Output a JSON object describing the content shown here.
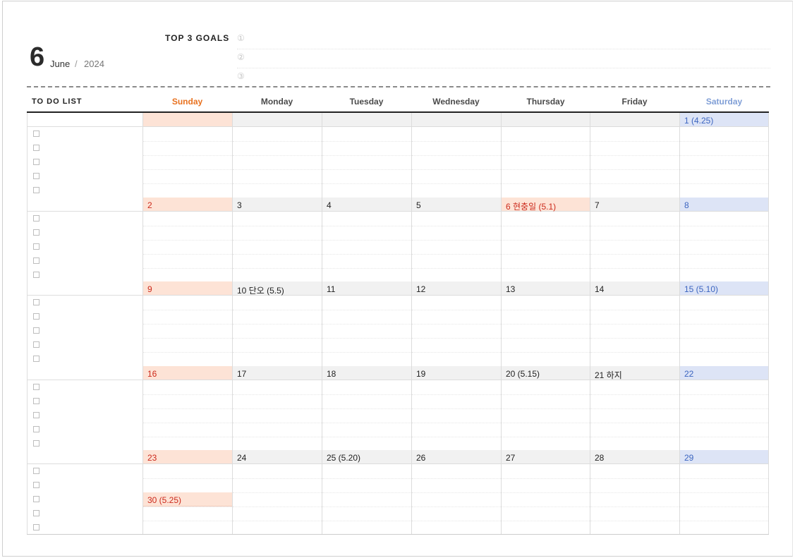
{
  "header": {
    "month_number": "6",
    "month_name": "June",
    "separator": "/",
    "year": "2024"
  },
  "goals": {
    "title": "TOP 3 GOALS",
    "items": [
      "①",
      "②",
      "③"
    ]
  },
  "todo": {
    "title": "TO DO LIST"
  },
  "weekdays": [
    "Sunday",
    "Monday",
    "Tuesday",
    "Wednesday",
    "Thursday",
    "Friday",
    "Saturday"
  ],
  "weeks": [
    [
      "",
      "",
      "",
      "",
      "",
      "",
      "1  (4.25)"
    ],
    [
      "2",
      "3",
      "4",
      "5",
      "6  현충일  (5.1)",
      "7",
      "8"
    ],
    [
      "9",
      "10  단오  (5.5)",
      "11",
      "12",
      "13",
      "14",
      "15  (5.10)"
    ],
    [
      "16",
      "17",
      "18",
      "19",
      "20  (5.15)",
      "21  하지",
      "22"
    ],
    [
      "23",
      "24",
      "25  (5.20)",
      "26",
      "27",
      "28",
      "29"
    ]
  ],
  "extra_day": "30  (5.25)",
  "colors": {
    "sunday": "#e8711f",
    "saturday": "#7f9ed6",
    "holiday_bg": "#fde3d6",
    "saturday_bg": "#dde4f6"
  }
}
